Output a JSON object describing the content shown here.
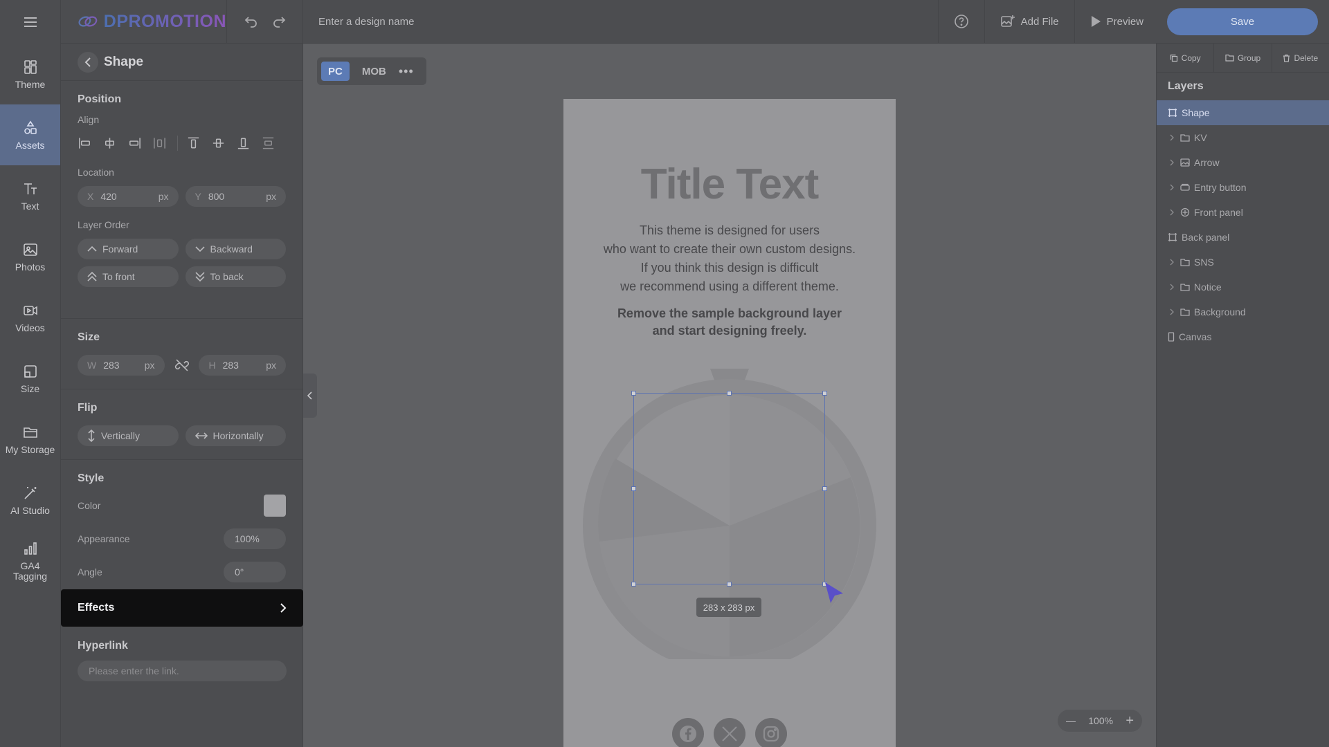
{
  "rail": {
    "items": [
      {
        "label": "Theme",
        "icon": "theme-icon"
      },
      {
        "label": "Assets",
        "icon": "assets-icon"
      },
      {
        "label": "Text",
        "icon": "text-icon"
      },
      {
        "label": "Photos",
        "icon": "photos-icon"
      },
      {
        "label": "Videos",
        "icon": "videos-icon"
      },
      {
        "label": "Size",
        "icon": "size-icon"
      },
      {
        "label": "My Storage",
        "icon": "folder-icon"
      },
      {
        "label": "AI Studio",
        "icon": "magic-wand-icon"
      },
      {
        "label": "GA4 Tagging",
        "icon": "bar-chart-icon"
      }
    ]
  },
  "topbar": {
    "logo": "DPROMOTION",
    "design_name_placeholder": "Enter a design name",
    "add_file": "Add File",
    "preview": "Preview",
    "save": "Save"
  },
  "panel": {
    "title": "Shape",
    "position": {
      "title": "Position",
      "align_label": "Align",
      "location_label": "Location",
      "x_key": "X",
      "x": "420",
      "y_key": "Y",
      "y": "800",
      "unit": "px",
      "layer_order_label": "Layer Order",
      "forward": "Forward",
      "backward": "Backward",
      "to_front": "To front",
      "to_back": "To back"
    },
    "size": {
      "title": "Size",
      "w_key": "W",
      "w": "283",
      "h_key": "H",
      "h": "283",
      "unit": "px"
    },
    "flip": {
      "title": "Flip",
      "vertically": "Vertically",
      "horizontally": "Horizontally"
    },
    "style": {
      "title": "Style",
      "color_label": "Color",
      "color_value": "#a3a3a6",
      "appearance_label": "Appearance",
      "appearance": "100%",
      "angle_label": "Angle",
      "angle": "0°"
    },
    "effects": "Effects",
    "hyperlink": {
      "title": "Hyperlink",
      "placeholder": "Please enter the link."
    }
  },
  "canvas": {
    "tabs": [
      "PC",
      "MOB"
    ],
    "active_tab": "PC",
    "title": "Title Text",
    "body_lines": [
      "This theme is designed for users",
      "who want to create their own custom designs.",
      "If you think this design is difficult",
      "we recommend using a different theme."
    ],
    "bold_lines": [
      "Remove the sample background layer",
      "and start designing freely."
    ],
    "selection_size": "283 x 283 px",
    "zoom": "100%"
  },
  "layers": {
    "actions": [
      "Copy",
      "Group",
      "Delete"
    ],
    "title": "Layers",
    "items": [
      {
        "name": "Shape",
        "icon": "shape-icon",
        "expandable": false,
        "active": true
      },
      {
        "name": "KV",
        "icon": "folder-icon",
        "expandable": true
      },
      {
        "name": "Arrow",
        "icon": "image-icon",
        "expandable": true
      },
      {
        "name": "Entry button",
        "icon": "button-icon",
        "expandable": true
      },
      {
        "name": "Front panel",
        "icon": "component-icon",
        "expandable": true
      },
      {
        "name": "Back panel",
        "icon": "shape-icon",
        "expandable": false
      },
      {
        "name": "SNS",
        "icon": "folder-icon",
        "expandable": true
      },
      {
        "name": "Notice",
        "icon": "folder-icon",
        "expandable": true
      },
      {
        "name": "Background",
        "icon": "folder-icon",
        "expandable": true
      },
      {
        "name": "Canvas",
        "icon": "canvas-icon",
        "expandable": false
      }
    ]
  }
}
